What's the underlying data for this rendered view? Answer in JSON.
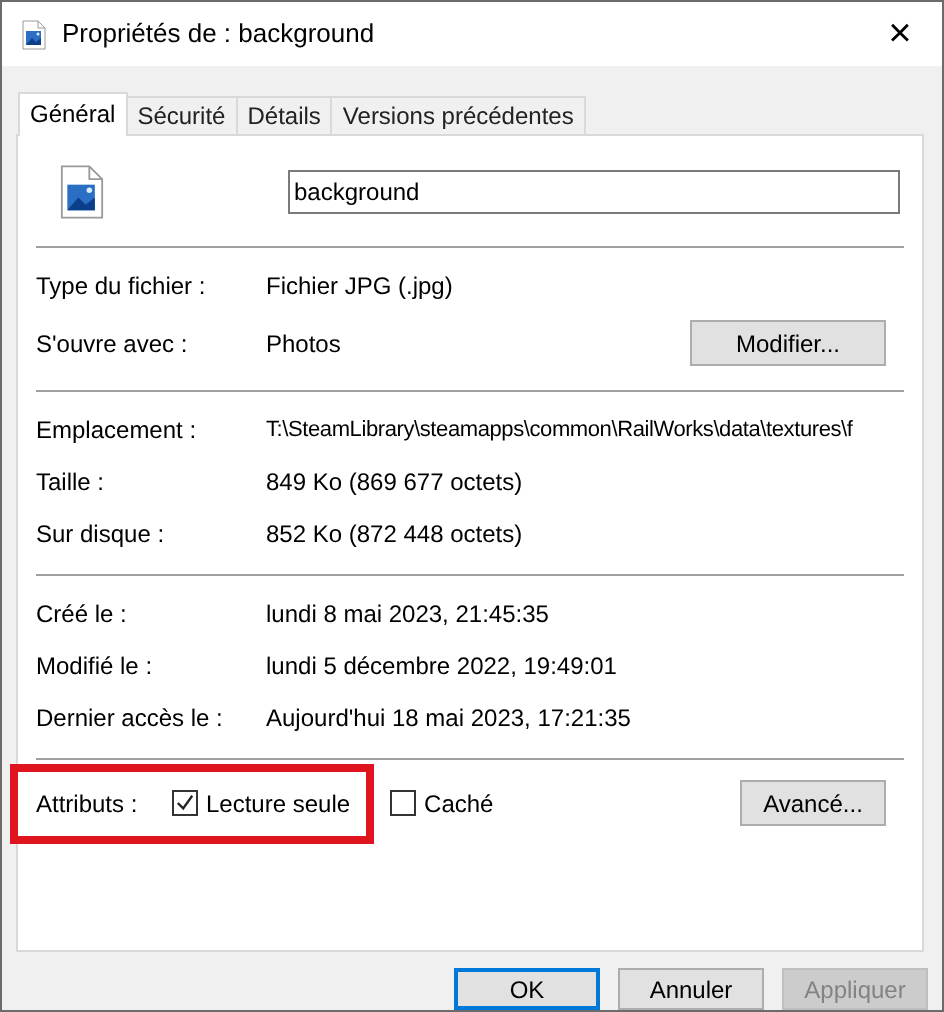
{
  "window": {
    "title": "Propriétés de : background",
    "close": "×"
  },
  "tabs": [
    {
      "label": "Général",
      "selected": true
    },
    {
      "label": "Sécurité",
      "selected": false
    },
    {
      "label": "Détails",
      "selected": false
    },
    {
      "label": "Versions précédentes",
      "selected": false
    }
  ],
  "file_name": "background",
  "sections": [
    {
      "rows": [
        {
          "label": "Type du fichier :",
          "value": "Fichier JPG (.jpg)"
        },
        {
          "label": "S'ouvre avec :",
          "value": "Photos",
          "button": "Modifier..."
        }
      ]
    },
    {
      "rows": [
        {
          "label": "Emplacement :",
          "value": "T:\\SteamLibrary\\steamapps\\common\\RailWorks\\data\\textures\\f"
        },
        {
          "label": "Taille :",
          "value": "849 Ko (869 677 octets)"
        },
        {
          "label": "Sur disque :",
          "value": "852 Ko (872 448 octets)"
        }
      ]
    },
    {
      "rows": [
        {
          "label": "Créé le :",
          "value": "lundi 8 mai 2023, 21:45:35"
        },
        {
          "label": "Modifié le :",
          "value": "lundi 5 décembre 2022, 19:49:01"
        },
        {
          "label": "Dernier accès le :",
          "value": "Aujourd'hui 18 mai 2023, 17:21:35"
        }
      ]
    }
  ],
  "attributes": {
    "label": "Attributs :",
    "highlighted": true,
    "items": [
      {
        "label": "Lecture seule",
        "checked": true
      },
      {
        "label": "Caché",
        "checked": false
      }
    ],
    "button": "Avancé..."
  },
  "buttons": [
    {
      "label": "OK",
      "default": true,
      "disabled": false
    },
    {
      "label": "Annuler",
      "default": false,
      "disabled": false
    },
    {
      "label": "Appliquer",
      "default": false,
      "disabled": true
    }
  ]
}
